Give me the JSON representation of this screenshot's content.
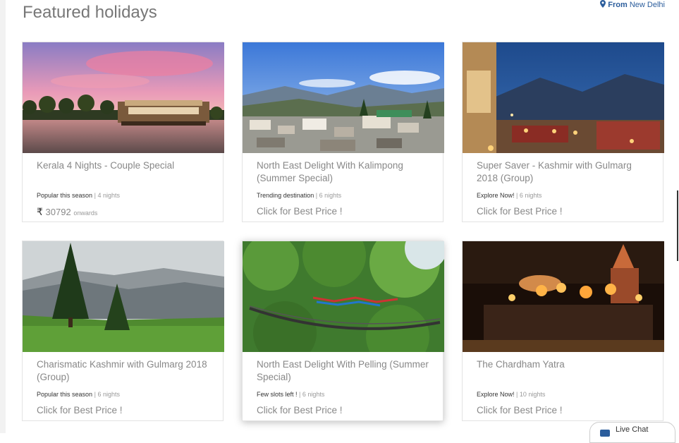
{
  "header": {
    "title": "Featured holidays",
    "from_label": "From",
    "from_city": "New Delhi"
  },
  "cards": [
    {
      "image_icon": "houseboat-sunset-image",
      "title": "Kerala 4 Nights - Couple Special",
      "tag": "Popular this season",
      "separator": "|",
      "duration": "4 nights",
      "currency": "₹",
      "price": "30792",
      "price_suffix": "onwards",
      "cta": ""
    },
    {
      "image_icon": "hill-town-image",
      "title": "North East Delight With Kalimpong (Summer Special)",
      "tag": "Trending destination",
      "separator": "|",
      "duration": "6 nights",
      "cta": "Click for Best Price !"
    },
    {
      "image_icon": "night-terrace-image",
      "title": "Super Saver - Kashmir with Gulmarg 2018 (Group)",
      "tag": "Explore Now!",
      "separator": "|",
      "duration": "6 nights",
      "cta": "Click for Best Price !"
    },
    {
      "image_icon": "kashmir-meadow-image",
      "title": "Charismatic Kashmir with Gulmarg 2018 (Group)",
      "tag": "Popular this season",
      "separator": "|",
      "duration": "6 nights",
      "cta": "Click for Best Price !"
    },
    {
      "image_icon": "suspension-bridge-image",
      "title": "North East Delight With Pelling (Summer Special)",
      "tag": "Few slots left !",
      "separator": "|",
      "duration": "6 nights",
      "cta": "Click for Best Price !"
    },
    {
      "image_icon": "ganga-aarti-image",
      "title": "The Chardham Yatra",
      "tag": "Explore Now!",
      "separator": "|",
      "duration": "10 nights",
      "cta": "Click for Best Price !"
    }
  ],
  "live_chat": {
    "label": "Live Chat"
  },
  "colors": {
    "accent": "#2b5d9c",
    "text_muted": "#888888"
  }
}
